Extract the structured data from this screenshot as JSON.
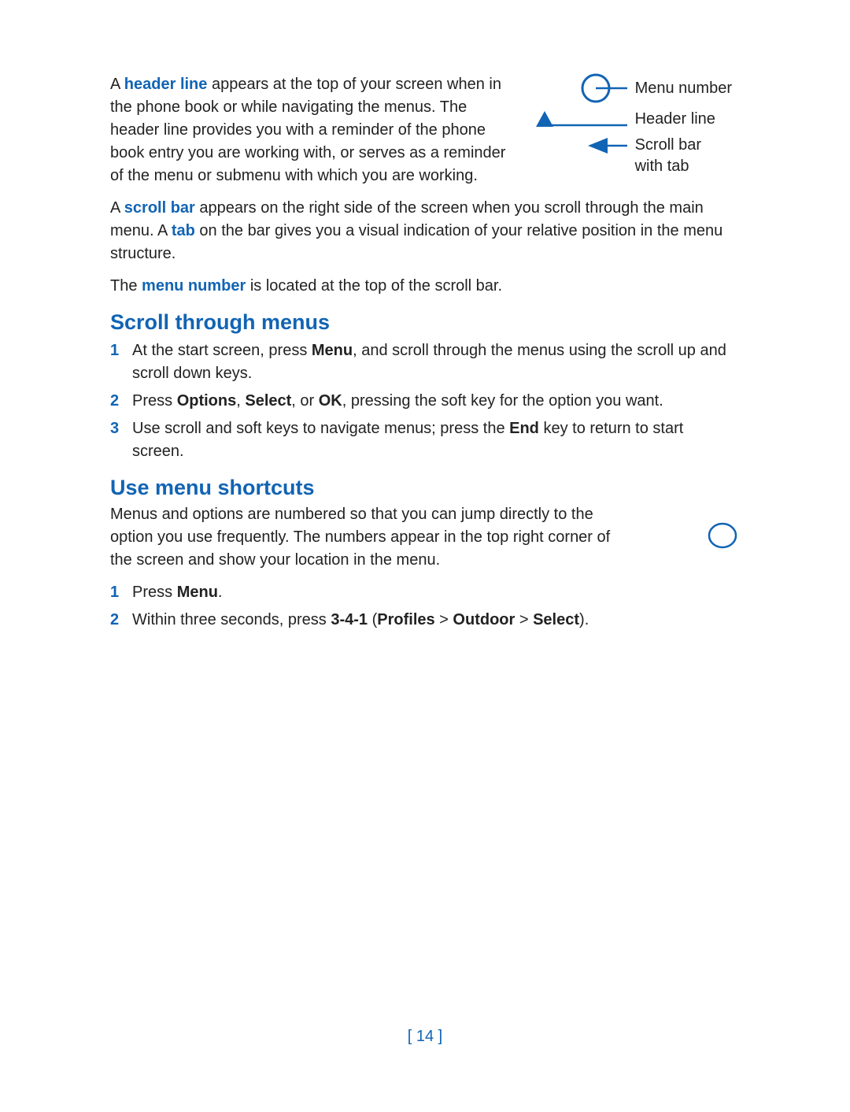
{
  "diagram": {
    "label_menu_number": "Menu number",
    "label_header_line": "Header line",
    "label_scroll_bar": "Scroll bar with tab"
  },
  "para1": {
    "pre": "A ",
    "term": "header line",
    "post": " appears at the top of your screen when in the phone book or while navigating the menus. The header line provides you with a reminder of the phone book entry you are working with, or serves as a reminder of the menu or submenu with which you are working."
  },
  "para2": {
    "pre": "A ",
    "term1": "scroll bar",
    "mid": " appears on the right side of the screen when you scroll through the main menu. A ",
    "term2": "tab",
    "post": " on the bar gives you a visual indication of your relative position in the menu structure."
  },
  "para3": {
    "pre": "The ",
    "term": "menu number",
    "post": " is located at the top of the scroll bar."
  },
  "section1": {
    "title": "Scroll through menus",
    "steps": {
      "s1a": "At the start screen, press ",
      "s1b": "Menu",
      "s1c": ", and scroll through the menus using the scroll up and scroll down keys.",
      "s2a": "Press ",
      "s2b": "Options",
      "s2c": ", ",
      "s2d": "Select",
      "s2e": ", or ",
      "s2f": "OK",
      "s2g": ", pressing the soft key for the option you want.",
      "s3a": "Use scroll and soft keys to navigate menus; press the ",
      "s3b": "End",
      "s3c": " key to return to start screen."
    }
  },
  "section2": {
    "title": "Use menu shortcuts",
    "intro": "Menus and options are numbered so that you can jump directly to the option you use frequently. The numbers appear in the top right corner of the screen and show your location in the menu.",
    "steps": {
      "s1a": "Press ",
      "s1b": "Menu",
      "s1c": ".",
      "s2a": "Within three seconds, press ",
      "s2b": "3-4-1",
      "s2c": " (",
      "s2d": "Profiles",
      "s2e": " > ",
      "s2f": "Outdoor",
      "s2g": " > ",
      "s2h": "Select",
      "s2i": ")."
    }
  },
  "pagenum": {
    "open": "[ ",
    "n": "14",
    "close": " ]"
  }
}
